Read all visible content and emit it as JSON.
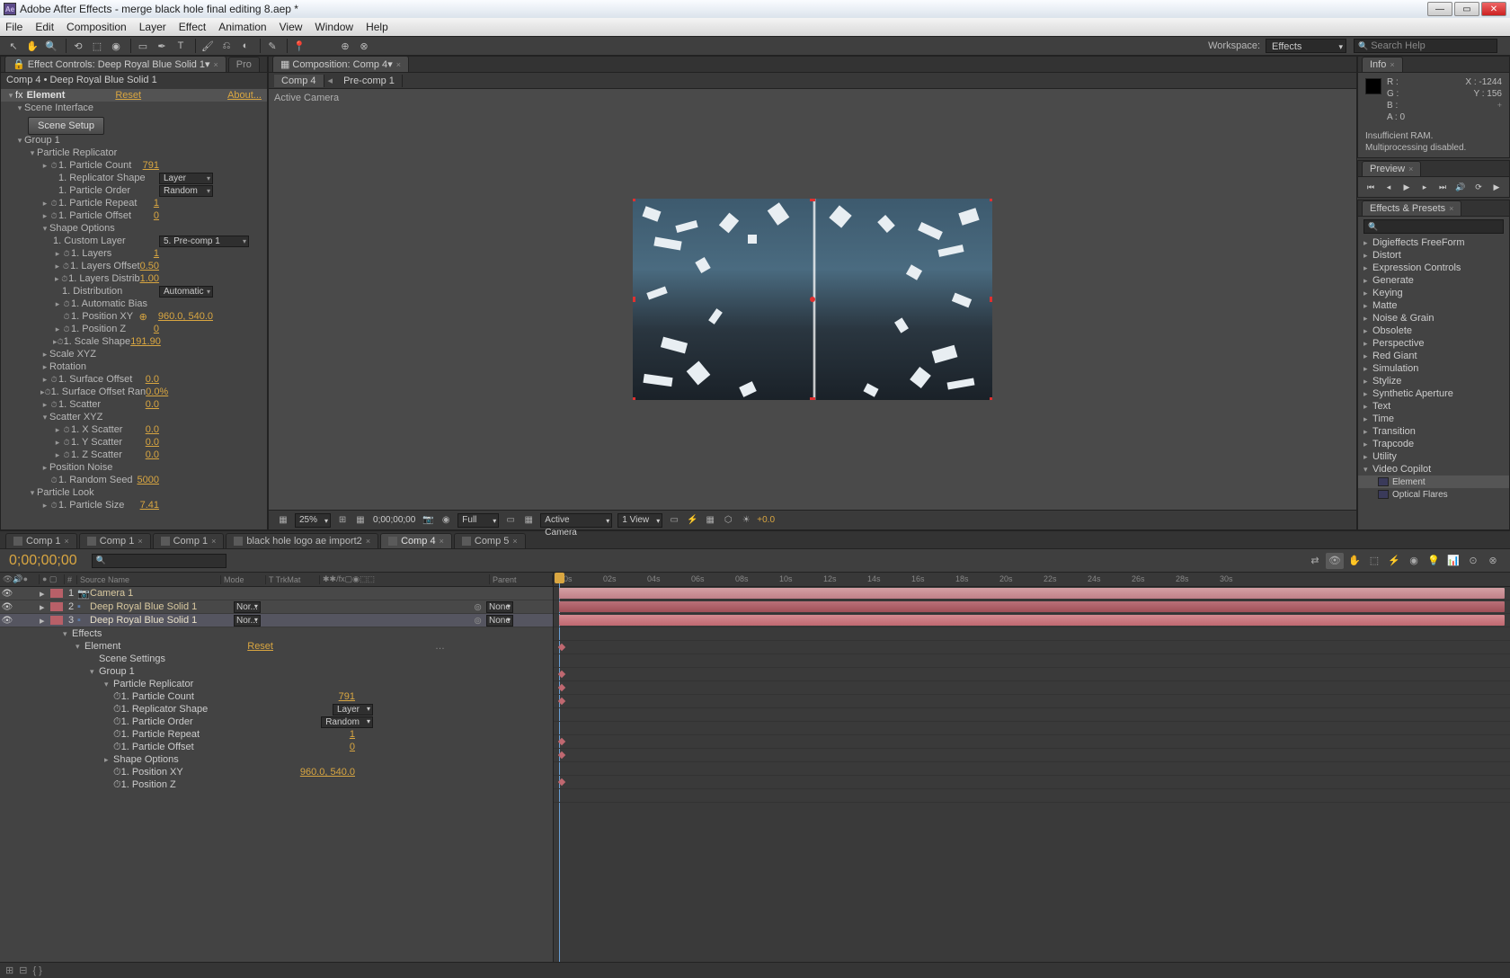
{
  "title": "Adobe After Effects - merge black hole final editing 8.aep *",
  "menu": [
    "File",
    "Edit",
    "Composition",
    "Layer",
    "Effect",
    "Animation",
    "View",
    "Window",
    "Help"
  ],
  "workspace": {
    "label": "Workspace:",
    "value": "Effects"
  },
  "search_placeholder": "Search Help",
  "effect_controls": {
    "tab": "Effect Controls: Deep Royal Blue Solid 1",
    "tab2": "Pro",
    "breadcrumb": "Comp 4 • Deep Royal Blue Solid 1",
    "effect_name": "Element",
    "reset": "Reset",
    "about": "About...",
    "scene_interface": "Scene Interface",
    "scene_setup": "Scene Setup",
    "group1": "Group 1",
    "particle_replicator": "Particle Replicator",
    "rows": {
      "count_l": "1. Particle Count",
      "count_v": "791",
      "shape_l": "1. Replicator Shape",
      "shape_v": "Layer",
      "order_l": "1. Particle Order",
      "order_v": "Random",
      "repeat_l": "1. Particle Repeat",
      "repeat_v": "1",
      "offset_l": "1. Particle Offset",
      "offset_v": "0",
      "shapeopt": "Shape Options",
      "custom_l": "1. Custom Layer",
      "custom_v": "5. Pre-comp 1",
      "layers_l": "1. Layers",
      "layers_v": "1",
      "loff_l": "1. Layers Offset",
      "loff_v": "0.50",
      "ldist_l": "1. Layers Distrib",
      "ldist_v": "1.00",
      "distrib_l": "1. Distribution",
      "distrib_v": "Automatic",
      "abias_l": "1. Automatic Bias",
      "posxy_l": "1. Position XY",
      "posxy_v": "960.0, 540.0",
      "posz_l": "1. Position Z",
      "posz_v": "0",
      "scale_l": "1. Scale Shape",
      "scale_v": "191.90",
      "scalexyz": "Scale XYZ",
      "rotation": "Rotation",
      "soff_l": "1. Surface Offset",
      "soff_v": "0.0",
      "soffr_l": "1. Surface Offset Ran",
      "soffr_v": "0.0%",
      "scatter_l": "1. Scatter",
      "scatter_v": "0.0",
      "scatterxyz": "Scatter XYZ",
      "xscat_l": "1. X Scatter",
      "xscat_v": "0.0",
      "yscat_l": "1. Y Scatter",
      "yscat_v": "0.0",
      "zscat_l": "1. Z Scatter",
      "zscat_v": "0.0",
      "posnoise": "Position Noise",
      "seed_l": "1. Random Seed",
      "seed_v": "5000",
      "plook": "Particle Look",
      "psize_l": "1. Particle Size",
      "psize_v": "7.41"
    }
  },
  "composition": {
    "tab": "Composition: Comp 4",
    "crumbs": [
      "Comp 4",
      "Pre-comp 1"
    ],
    "active_camera": "Active Camera",
    "footer": {
      "zoom": "25%",
      "timecode": "0;00;00;00",
      "res": "Full",
      "camera": "Active Camera",
      "view": "1 View",
      "exposure": "+0.0"
    }
  },
  "info": {
    "title": "Info",
    "r": "R :",
    "g": "G :",
    "b": "B :",
    "a": "A :  0",
    "x": "X : -1244",
    "y": "Y :  156",
    "msg1": "Insufficient RAM.",
    "msg2": "Multiprocessing disabled."
  },
  "preview": {
    "title": "Preview"
  },
  "effects_presets": {
    "title": "Effects & Presets",
    "items": [
      "Digieffects FreeForm",
      "Distort",
      "Expression Controls",
      "Generate",
      "Keying",
      "Matte",
      "Noise & Grain",
      "Obsolete",
      "Perspective",
      "Red Giant",
      "Simulation",
      "Stylize",
      "Synthetic Aperture",
      "Text",
      "Time",
      "Transition",
      "Trapcode",
      "Utility"
    ],
    "vc": "Video Copilot",
    "vc_items": [
      "Element",
      "Optical Flares"
    ]
  },
  "timeline": {
    "tabs": [
      "Comp 1",
      "Comp 1",
      "Comp 1",
      "black hole logo ae import2",
      "Comp 4",
      "Comp 5"
    ],
    "active_tab": 4,
    "time": "0;00;00;00",
    "colhead": {
      "num": "#",
      "source": "Source Name",
      "mode": "Mode",
      "trk": "T   TrkMat",
      "parent": "Parent"
    },
    "layers": [
      {
        "num": "1",
        "name": "Camera 1",
        "color": "#b86068",
        "cam": true
      },
      {
        "num": "2",
        "name": "Deep Royal Blue Solid 1",
        "color": "#b86068",
        "mode": "Nor...",
        "parent": "None"
      },
      {
        "num": "3",
        "name": "Deep Royal Blue Solid 1",
        "color": "#b86068",
        "mode": "Nor...",
        "parent": "None",
        "sel": true
      }
    ],
    "props": {
      "effects": "Effects",
      "element": "Element",
      "reset": "Reset",
      "scene": "Scene Settings",
      "group1": "Group 1",
      "prep": "Particle Replicator",
      "count_l": "1. Particle Count",
      "count_v": "791",
      "shape_l": "1. Replicator Shape",
      "shape_v": "Layer",
      "order_l": "1. Particle Order",
      "order_v": "Random",
      "repeat_l": "1. Particle Repeat",
      "repeat_v": "1",
      "offset_l": "1. Particle Offset",
      "offset_v": "0",
      "shapeopt": "Shape Options",
      "posxy_l": "1. Position XY",
      "posxy_v": "960.0, 540.0",
      "posz_l": "1. Position Z"
    },
    "ruler": [
      "00s",
      "02s",
      "04s",
      "06s",
      "08s",
      "10s",
      "12s",
      "14s",
      "16s",
      "18s",
      "20s",
      "22s",
      "24s",
      "26s",
      "28s",
      "30s"
    ]
  }
}
